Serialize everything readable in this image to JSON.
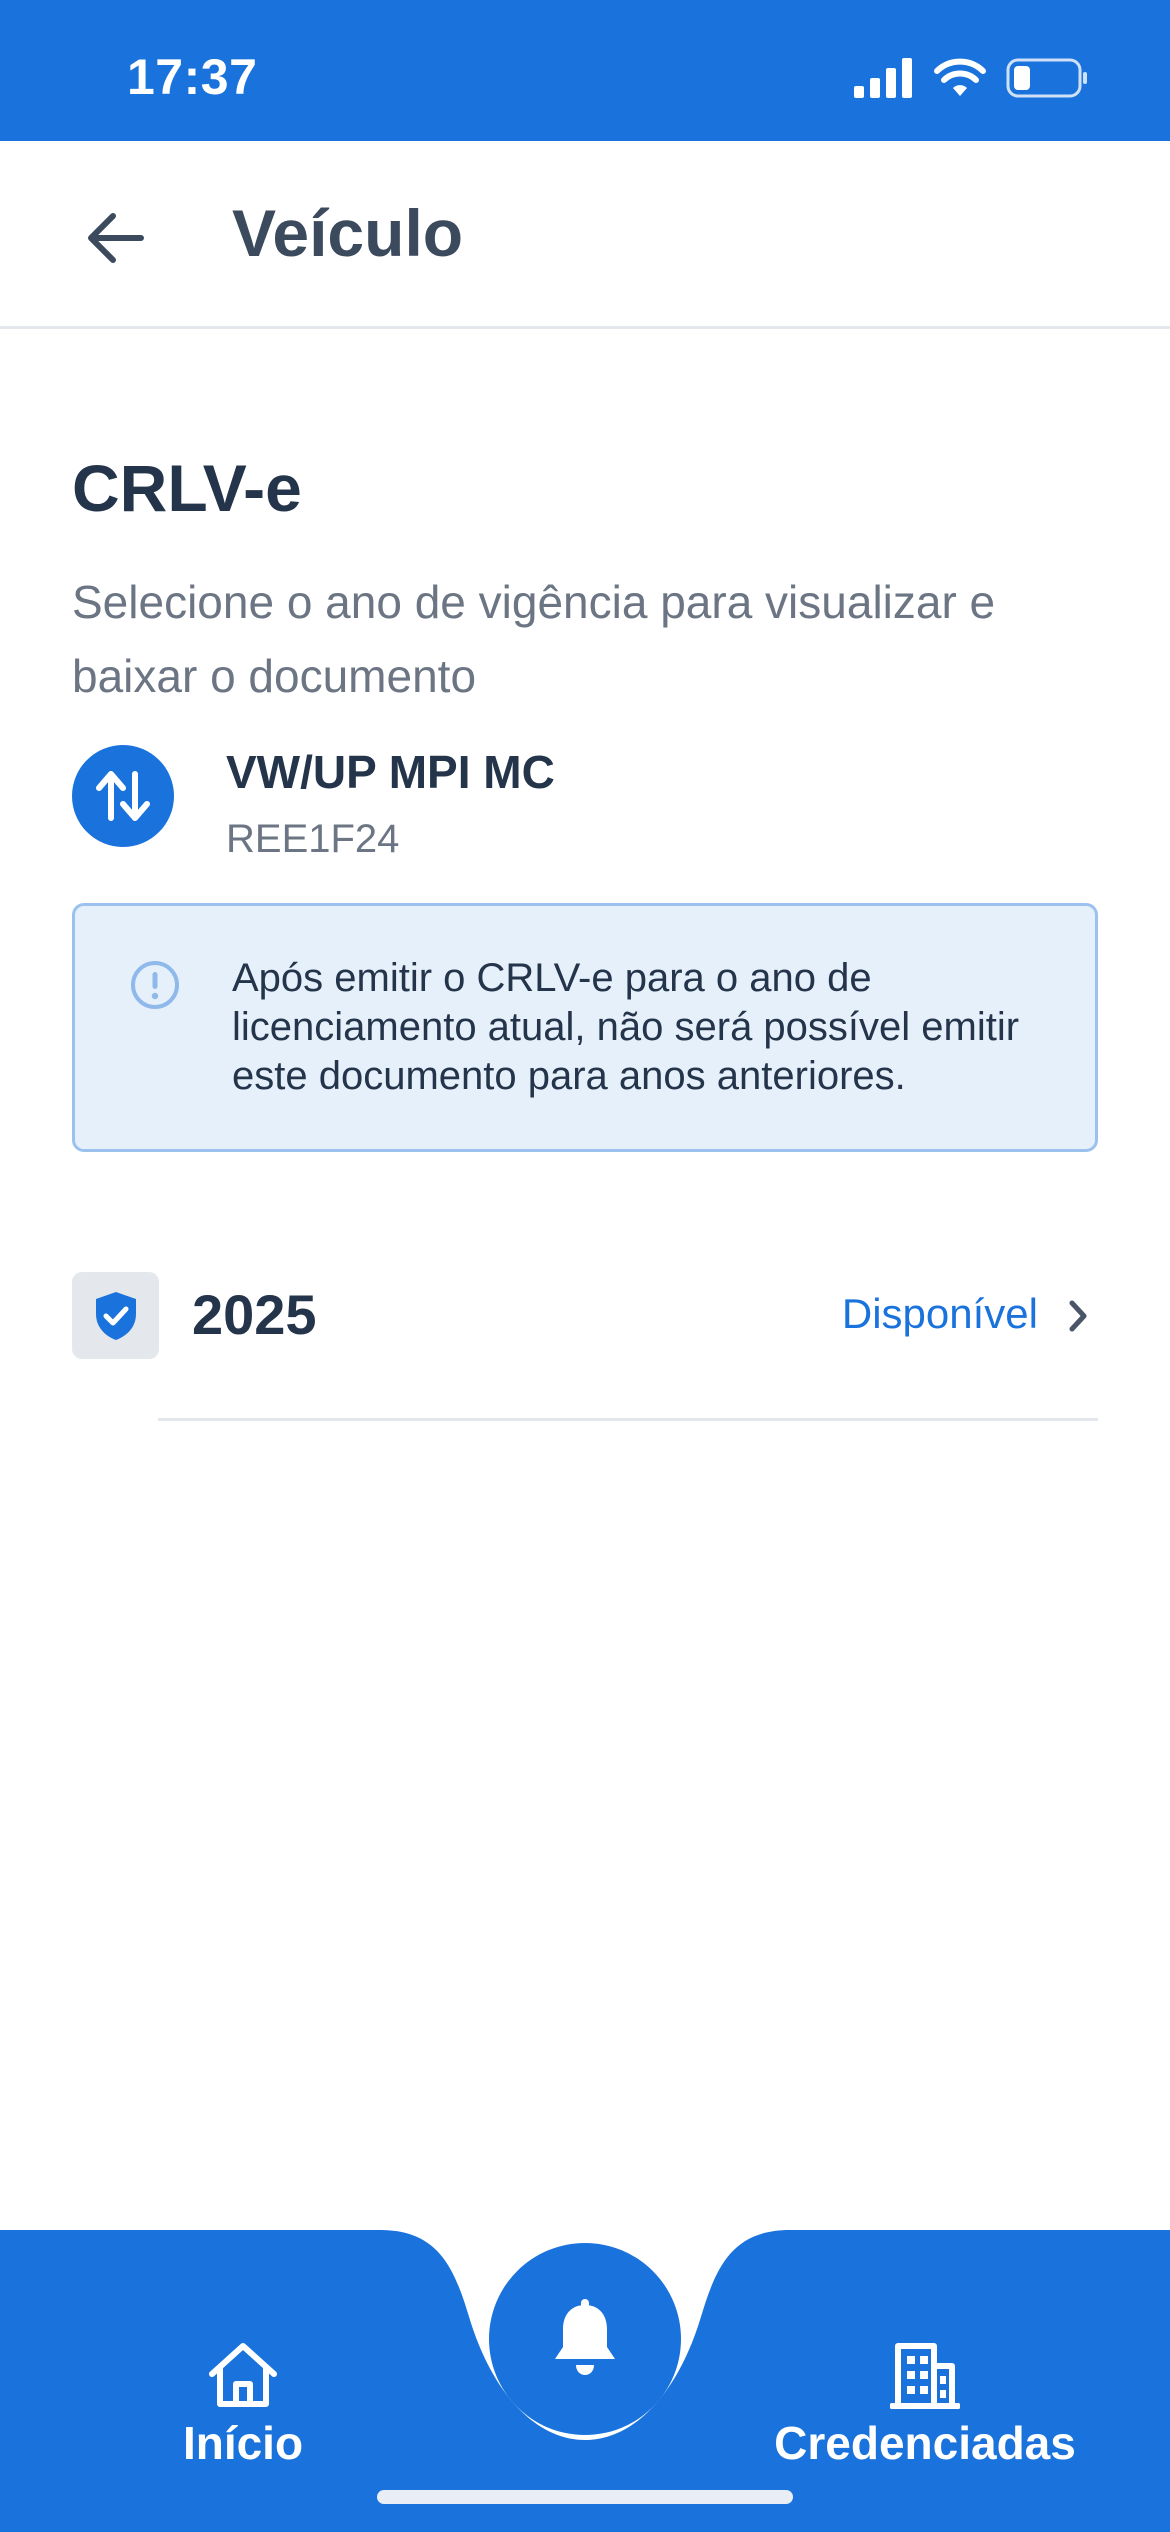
{
  "status_bar": {
    "time": "17:37"
  },
  "header": {
    "title": "Veículo",
    "back_icon": "arrow-left-icon"
  },
  "content": {
    "section_title": "CRLV-e",
    "description": "Selecione o ano de vigência para visualizar e baixar o documento",
    "vehicle": {
      "name": "VW/UP MPI MC",
      "plate": "REE1F24",
      "icon": "swap-vertical-icon"
    },
    "info_notice": "Após emitir o CRLV-e para o ano de licenciamento atual, não será possível emitir este documento para anos anteriores.",
    "years": [
      {
        "year": "2025",
        "status": "Disponível",
        "icon": "shield-check-icon"
      }
    ]
  },
  "bottom_nav": {
    "items": [
      {
        "label": "Início",
        "icon": "home-icon"
      },
      {
        "label": "Credenciadas",
        "icon": "building-icon"
      }
    ],
    "fab_icon": "bell-icon"
  },
  "colors": {
    "primary": "#1a73dc",
    "info_bg": "#e6f0fb",
    "info_border": "#9bc2ee",
    "text_dark": "#24344a",
    "text_muted": "#6b7583"
  }
}
